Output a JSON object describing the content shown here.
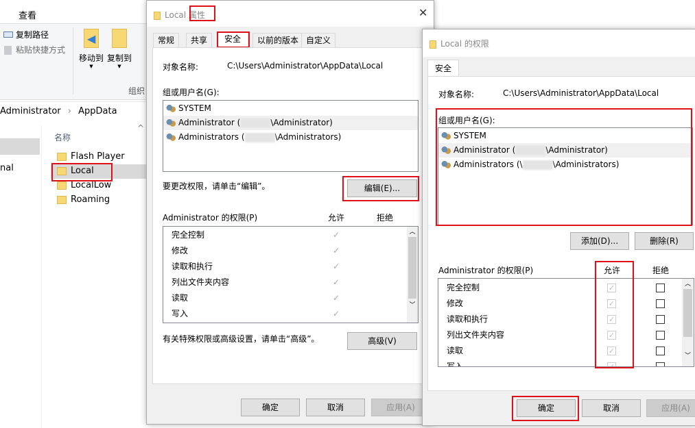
{
  "explorer": {
    "ribbon_tab": "查看",
    "copy_path": "复制路径",
    "paste_shortcut": "粘贴快捷方式",
    "move_to": "移动到",
    "copy_to": "复制到",
    "group_label": "组织",
    "breadcrumb": [
      "Administrator",
      "AppData"
    ],
    "nav_partial": "nal",
    "column_name": "名称",
    "files": [
      "Flash Player",
      "Local",
      "LocalLow",
      "Roaming"
    ],
    "selected_file": "Local"
  },
  "props": {
    "title_name": "Local",
    "title_suffix": "属性",
    "tabs": [
      "常规",
      "共享",
      "安全",
      "以前的版本",
      "自定义"
    ],
    "active_tab": "安全",
    "object_label": "对象名称:",
    "object_value": "C:\\Users\\Administrator\\AppData\\Local",
    "group_label": "组或用户名(G):",
    "users": [
      {
        "pre": "SYSTEM",
        "post": ""
      },
      {
        "pre": "Administrator (",
        "post": "\\Administrator)"
      },
      {
        "pre": "Administrators (",
        "post": "\\Administrators)"
      }
    ],
    "edit_hint": "要更改权限，请单击“编辑”。",
    "edit_button": "编辑(E)...",
    "perm_label": "Administrator 的权限(P)",
    "allow": "允许",
    "deny": "拒绝",
    "perms": [
      "完全控制",
      "修改",
      "读取和执行",
      "列出文件夹内容",
      "读取",
      "写入"
    ],
    "advanced_hint": "有关特殊权限或高级设置，请单击“高级”。",
    "advanced_button": "高级(V)",
    "ok": "确定",
    "cancel": "取消",
    "apply": "应用(A)"
  },
  "perm_dialog": {
    "title": "Local 的权限",
    "tab": "安全",
    "object_label": "对象名称:",
    "object_value": "C:\\Users\\Administrator\\AppData\\Local",
    "group_label": "组或用户名(G):",
    "users": [
      {
        "pre": "SYSTEM",
        "post": ""
      },
      {
        "pre": "Administrator (",
        "post": "\\Administrator)"
      },
      {
        "pre": "Administrators (\\",
        "post": "\\Administrators)"
      }
    ],
    "add_button": "添加(D)...",
    "remove_button": "删除(R)",
    "perm_label": "Administrator 的权限(P)",
    "allow": "允许",
    "deny": "拒绝",
    "perms": [
      "完全控制",
      "修改",
      "读取和执行",
      "列出文件夹内容",
      "读取",
      "写入"
    ],
    "ok": "确定",
    "cancel": "取消",
    "apply": "应用(A)"
  },
  "colors": {
    "highlight": "#e0101a",
    "selected_row": "#d9d9d9"
  }
}
